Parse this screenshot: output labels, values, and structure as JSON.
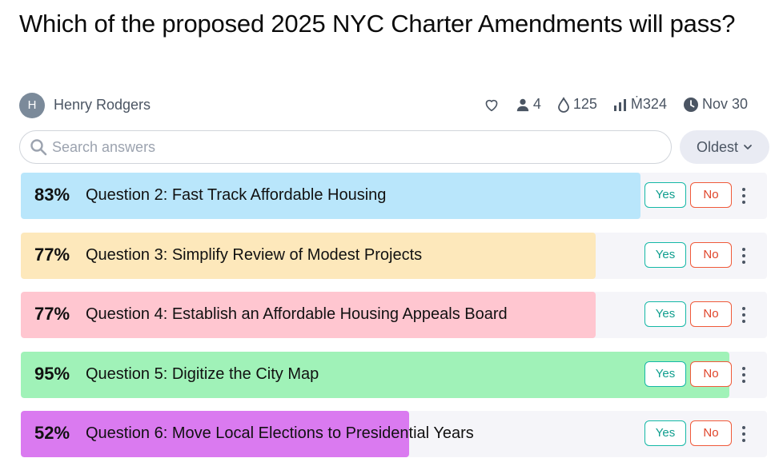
{
  "title": "Which of the proposed 2025 NYC Charter Amendments will pass?",
  "author": {
    "initial": "H",
    "name": "Henry Rodgers"
  },
  "stats": {
    "traders": "4",
    "liquidity": "125",
    "volume": "Ṁ324",
    "close_date": "Nov 30"
  },
  "search": {
    "placeholder": "Search answers"
  },
  "sort": {
    "label": "Oldest"
  },
  "buttons": {
    "yes": "Yes",
    "no": "No"
  },
  "answers": [
    {
      "percent_label": "83%",
      "probability": 0.83,
      "text": "Question 2: Fast Track Affordable Housing",
      "color": "#b9e6fb"
    },
    {
      "percent_label": "77%",
      "probability": 0.77,
      "text": "Question 3: Simplify Review of Modest Projects",
      "color": "#fde8bb"
    },
    {
      "percent_label": "77%",
      "probability": 0.77,
      "text": "Question 4: Establish an Affordable Housing Appeals Board",
      "color": "#ffc6d0"
    },
    {
      "percent_label": "95%",
      "probability": 0.95,
      "text": "Question 5: Digitize the City Map",
      "color": "#a0f2b8"
    },
    {
      "percent_label": "52%",
      "probability": 0.52,
      "text": "Question 6: Move Local Elections to Presidential Years",
      "color": "#da7af0"
    }
  ]
}
